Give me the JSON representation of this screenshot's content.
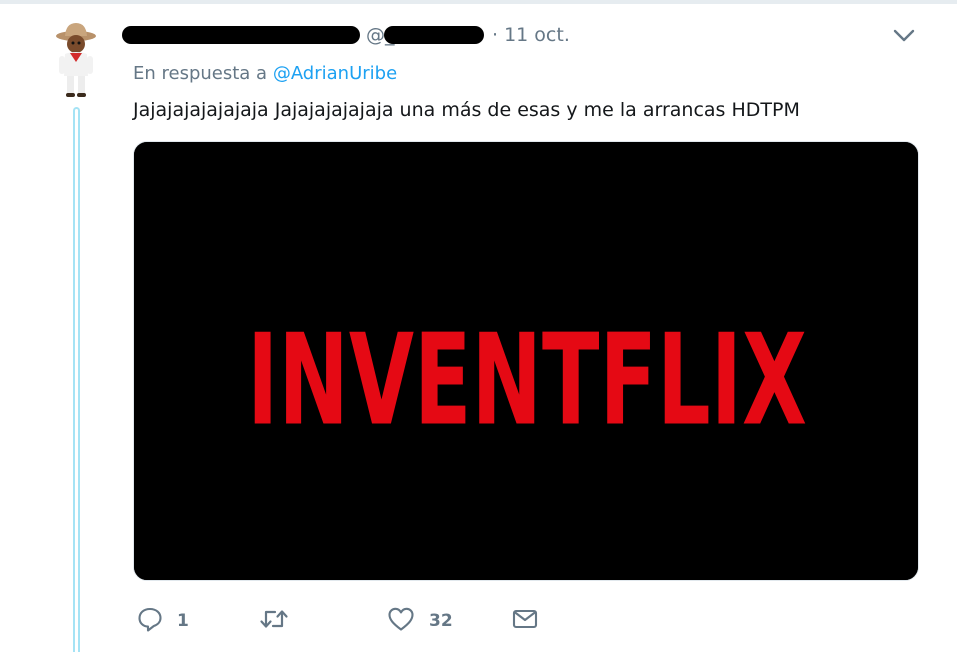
{
  "tweet": {
    "handle_prefix": "@_",
    "timestamp": "· 11 oct.",
    "reply_prefix": "En respuesta a ",
    "reply_handle": "@AdrianUribe",
    "text": "Jajajajajajajaja Jajajajajajaja una más de esas y me la arrancas HDTPM",
    "media": {
      "logo_text": "INVENTFLIX",
      "logo_color": "#e50914",
      "background": "#000000"
    }
  },
  "actions": {
    "reply_count": "1",
    "retweet_count": "",
    "like_count": "32"
  },
  "icons": {
    "reply": "reply-icon",
    "retweet": "retweet-icon",
    "like": "heart-icon",
    "dm": "envelope-icon",
    "menu": "chevron-down-icon"
  },
  "colors": {
    "link": "#1da1f2",
    "secondary_text": "#657786",
    "thread_line": "#a5e3f5"
  }
}
